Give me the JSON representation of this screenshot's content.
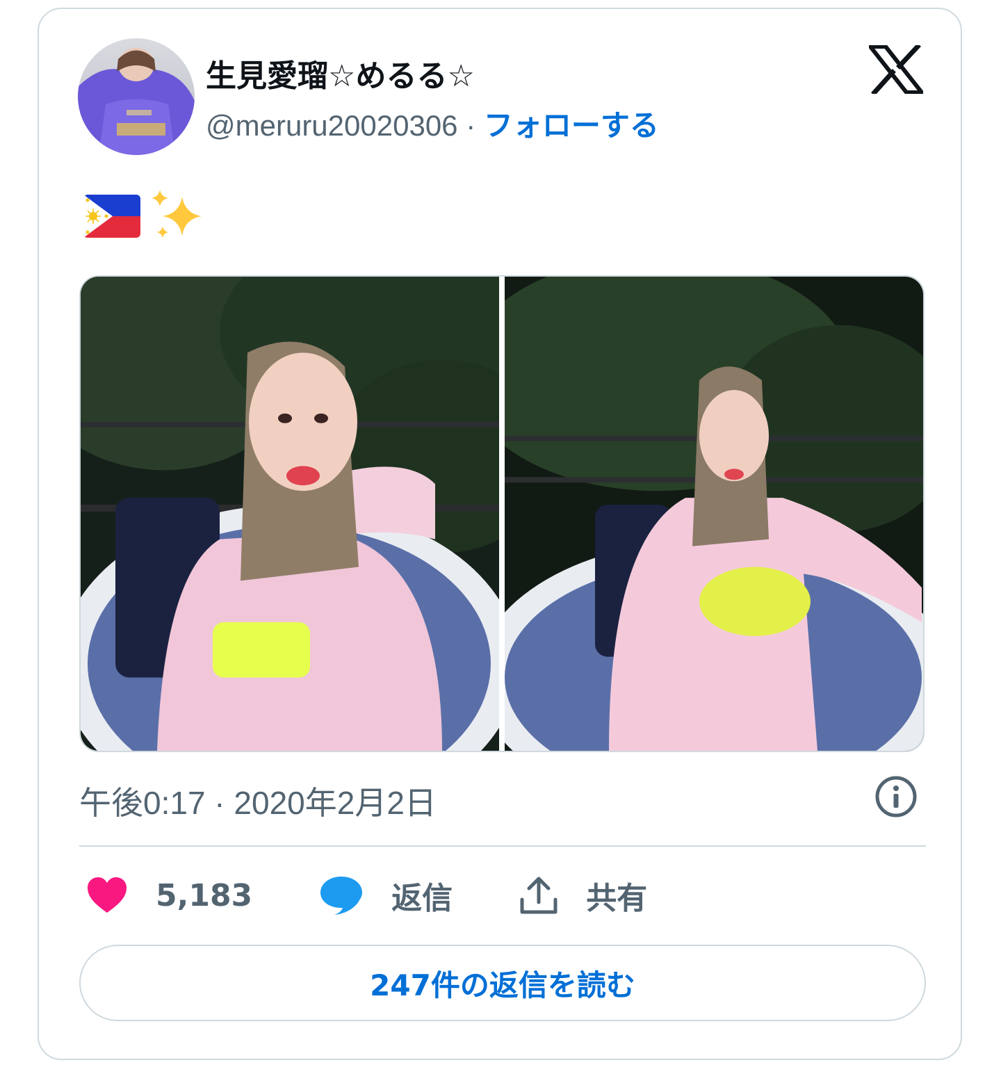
{
  "colors": {
    "accent": "#006fd6",
    "secondary_text": "#536471",
    "primary_text": "#0f1419",
    "border": "#cfd9de",
    "heart": "#f91880",
    "reply_bubble": "#1d9bf0"
  },
  "author": {
    "display_name": "生見愛瑠☆めるる☆",
    "handle": "@meruru20020306",
    "separator": " · ",
    "follow_label": "フォローする",
    "avatar_icon": "profile-photo"
  },
  "tweet": {
    "emojis": [
      "flag-philippines",
      "sparkles"
    ],
    "photos": [
      "photo-1",
      "photo-2"
    ],
    "timestamp": "午後0:17 · 2020年2月2日"
  },
  "actions": {
    "likes_count": "5,183",
    "reply_label": "返信",
    "share_label": "共有"
  },
  "footer": {
    "read_replies_label": "247件の返信を読む"
  },
  "icons": {
    "logo": "x-logo",
    "info": "info-icon",
    "like": "heart-icon",
    "reply": "speech-bubble-icon",
    "share": "share-upload-icon"
  }
}
